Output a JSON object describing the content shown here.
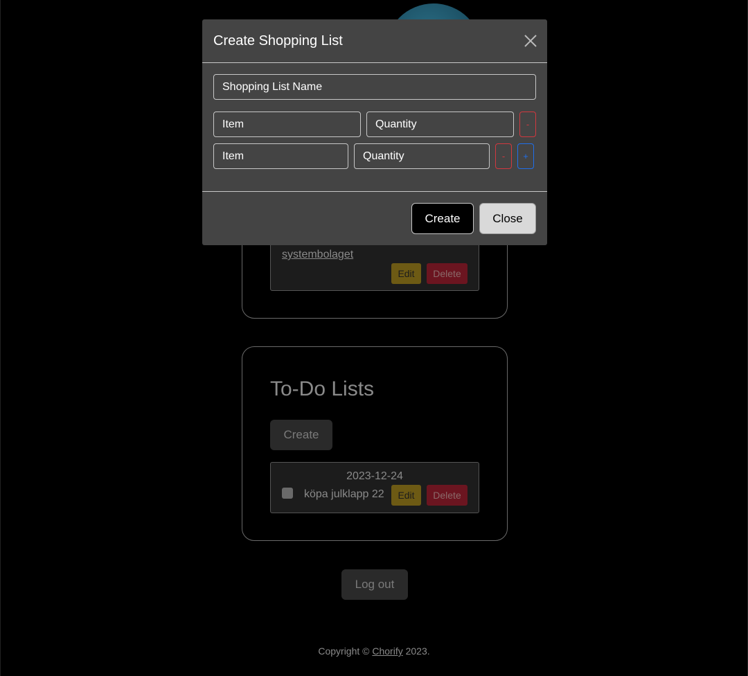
{
  "modal": {
    "title": "Create Shopping List",
    "name_placeholder": "Shopping List Name",
    "rows": [
      {
        "item_placeholder": "Item",
        "quantity_placeholder": "Quantity",
        "remove_label": "-"
      },
      {
        "item_placeholder": "Item",
        "quantity_placeholder": "Quantity",
        "remove_label": "-",
        "add_label": "+"
      }
    ],
    "create_label": "Create",
    "close_label": "Close"
  },
  "shopping_lists": {
    "items": [
      {
        "name": "systembolaget",
        "edit_label": "Edit",
        "delete_label": "Delete"
      }
    ]
  },
  "todo_lists": {
    "title": "To-Do Lists",
    "create_label": "Create",
    "items": [
      {
        "date": "2023-12-24",
        "text": "köpa julklapp 22",
        "edit_label": "Edit",
        "delete_label": "Delete"
      }
    ]
  },
  "logout_label": "Log out",
  "footer": {
    "prefix": "Copyright © ",
    "brand": "Chorify",
    "suffix": " 2023."
  }
}
